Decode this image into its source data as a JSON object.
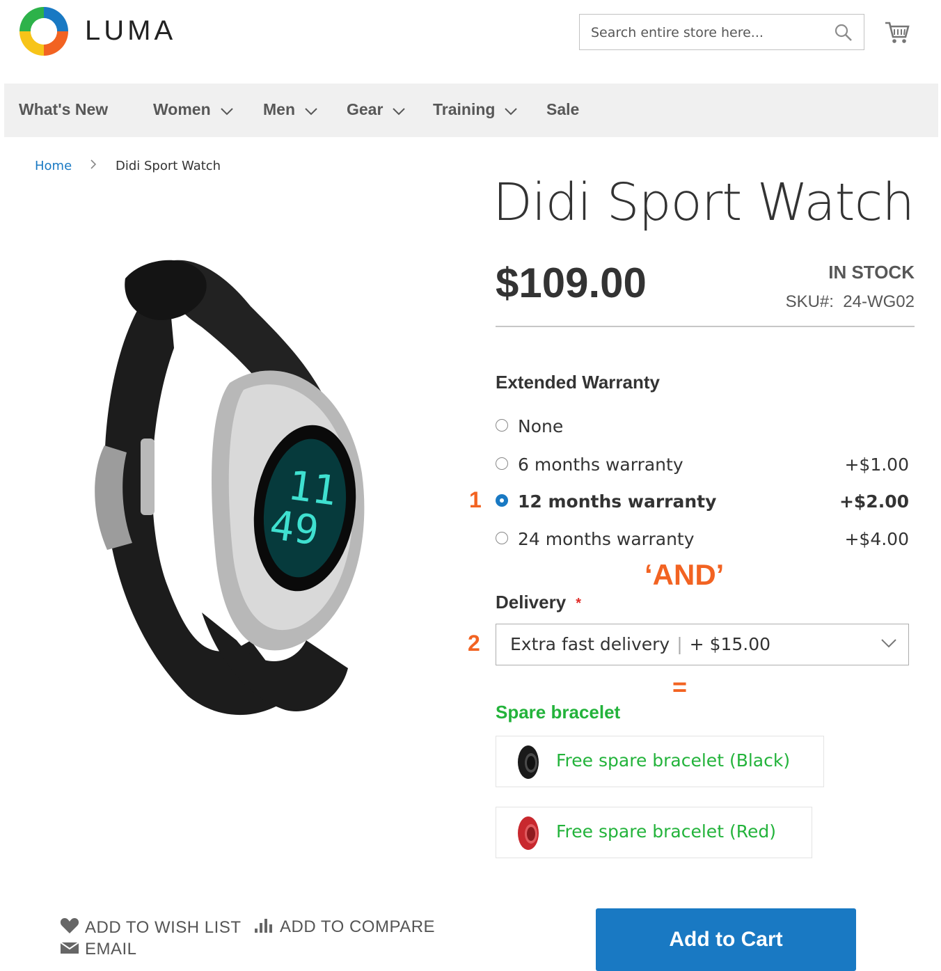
{
  "header": {
    "logo_text": "LUMA",
    "search_placeholder": "Search entire store here..."
  },
  "nav": {
    "items": [
      {
        "label": "What's New",
        "dropdown": false
      },
      {
        "label": "Women",
        "dropdown": true
      },
      {
        "label": "Men",
        "dropdown": true
      },
      {
        "label": "Gear",
        "dropdown": true
      },
      {
        "label": "Training",
        "dropdown": true
      },
      {
        "label": "Sale",
        "dropdown": false
      }
    ]
  },
  "breadcrumb": {
    "home": "Home",
    "current": "Didi Sport Watch"
  },
  "product": {
    "title": "Didi Sport Watch",
    "price": "$109.00",
    "stock": "IN STOCK",
    "sku_label": "SKU#:",
    "sku": "24-WG02"
  },
  "warranty": {
    "title": "Extended Warranty",
    "marker": "1",
    "options": [
      {
        "label": "None",
        "amount": "",
        "selected": false
      },
      {
        "label": "6 months warranty",
        "amount": "+$1.00",
        "selected": false
      },
      {
        "label": "12 months warranty",
        "amount": "+$2.00",
        "selected": true
      },
      {
        "label": "24 months warranty",
        "amount": "+$4.00",
        "selected": false
      }
    ]
  },
  "annotations": {
    "and_text": "‘AND’",
    "equals_text": "="
  },
  "delivery": {
    "title": "Delivery",
    "required_mark": "*",
    "marker": "2",
    "selected_label": "Extra fast delivery",
    "selected_amount": "+ $15.00"
  },
  "spare": {
    "title": "Spare bracelet",
    "items": [
      {
        "label": "Free spare bracelet (Black)",
        "color": "#1a1a1a"
      },
      {
        "label": "Free spare bracelet (Red)",
        "color": "#c8282e"
      }
    ]
  },
  "actions": {
    "wishlist": "ADD TO WISH LIST",
    "compare": "ADD TO COMPARE",
    "email": "EMAIL",
    "add_to_cart": "Add to Cart"
  },
  "colors": {
    "accent": "#1979c3",
    "annotation": "#f26322",
    "spare_green": "#23b33b"
  },
  "icons": {
    "logo": "luma-logo-icon",
    "search": "search-icon",
    "cart": "cart-icon",
    "wishlist": "heart-icon",
    "compare": "bar-chart-icon",
    "email": "envelope-icon"
  }
}
